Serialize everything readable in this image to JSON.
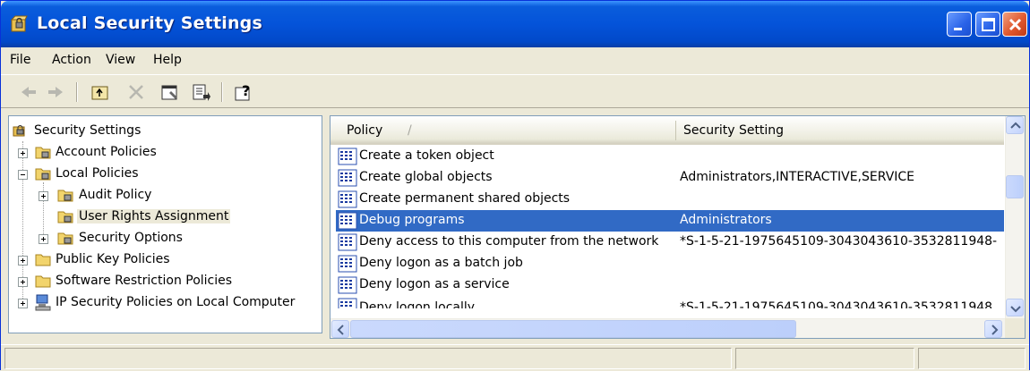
{
  "window": {
    "title": "Local Security Settings",
    "colors": {
      "titlebar": "#0453d9",
      "selection": "#316ac5",
      "face": "#ece9d8"
    }
  },
  "menu": [
    "File",
    "Action",
    "View",
    "Help"
  ],
  "toolbar": {
    "icons": [
      "back-arrow-icon",
      "forward-arrow-icon",
      "up-folder-icon",
      "delete-icon",
      "properties-icon",
      "export-list-icon",
      "help-icon"
    ]
  },
  "tree": {
    "root": "Security Settings",
    "items": [
      {
        "label": "Account Policies",
        "expander": "plus"
      },
      {
        "label": "Local Policies",
        "expander": "minus"
      },
      {
        "label": "Audit Policy",
        "expander": "plus"
      },
      {
        "label": "User Rights Assignment",
        "expander": "none",
        "selected": true
      },
      {
        "label": "Security Options",
        "expander": "plus"
      },
      {
        "label": "Public Key Policies",
        "expander": "plus"
      },
      {
        "label": "Software Restriction Policies",
        "expander": "plus"
      },
      {
        "label": "IP Security Policies on Local Computer",
        "expander": "plus"
      }
    ]
  },
  "list": {
    "columns": [
      "Policy",
      "Security Setting"
    ],
    "sort_indicator": "/",
    "rows": [
      {
        "policy": "Create a token object",
        "setting": ""
      },
      {
        "policy": "Create global objects",
        "setting": "Administrators,INTERACTIVE,SERVICE"
      },
      {
        "policy": "Create permanent shared objects",
        "setting": ""
      },
      {
        "policy": "Debug programs",
        "setting": "Administrators",
        "selected": true
      },
      {
        "policy": "Deny access to this computer from the network",
        "setting": "*S-1-5-21-1975645109-3043043610-3532811948-"
      },
      {
        "policy": "Deny logon as a batch job",
        "setting": ""
      },
      {
        "policy": "Deny logon as a service",
        "setting": ""
      },
      {
        "policy": "Deny logon locally",
        "setting": "*S-1-5-21-1975645109-3043043610-3532811948"
      }
    ]
  }
}
